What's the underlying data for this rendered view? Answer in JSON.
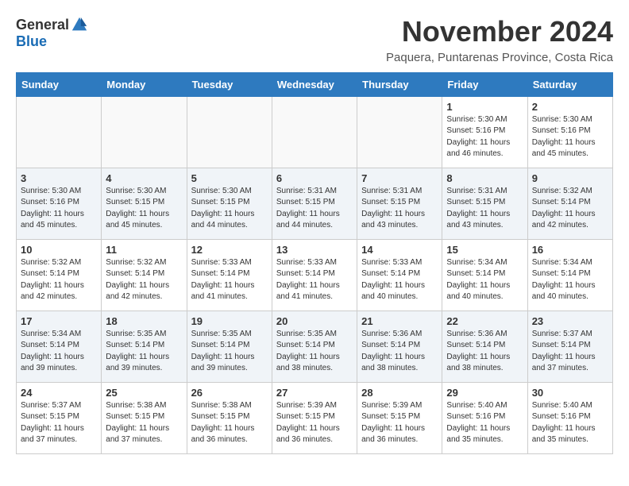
{
  "logo": {
    "general": "General",
    "blue": "Blue"
  },
  "header": {
    "month": "November 2024",
    "location": "Paquera, Puntarenas Province, Costa Rica"
  },
  "weekdays": [
    "Sunday",
    "Monday",
    "Tuesday",
    "Wednesday",
    "Thursday",
    "Friday",
    "Saturday"
  ],
  "weeks": [
    [
      {
        "day": "",
        "info": ""
      },
      {
        "day": "",
        "info": ""
      },
      {
        "day": "",
        "info": ""
      },
      {
        "day": "",
        "info": ""
      },
      {
        "day": "",
        "info": ""
      },
      {
        "day": "1",
        "info": "Sunrise: 5:30 AM\nSunset: 5:16 PM\nDaylight: 11 hours\nand 46 minutes."
      },
      {
        "day": "2",
        "info": "Sunrise: 5:30 AM\nSunset: 5:16 PM\nDaylight: 11 hours\nand 45 minutes."
      }
    ],
    [
      {
        "day": "3",
        "info": "Sunrise: 5:30 AM\nSunset: 5:16 PM\nDaylight: 11 hours\nand 45 minutes."
      },
      {
        "day": "4",
        "info": "Sunrise: 5:30 AM\nSunset: 5:15 PM\nDaylight: 11 hours\nand 45 minutes."
      },
      {
        "day": "5",
        "info": "Sunrise: 5:30 AM\nSunset: 5:15 PM\nDaylight: 11 hours\nand 44 minutes."
      },
      {
        "day": "6",
        "info": "Sunrise: 5:31 AM\nSunset: 5:15 PM\nDaylight: 11 hours\nand 44 minutes."
      },
      {
        "day": "7",
        "info": "Sunrise: 5:31 AM\nSunset: 5:15 PM\nDaylight: 11 hours\nand 43 minutes."
      },
      {
        "day": "8",
        "info": "Sunrise: 5:31 AM\nSunset: 5:15 PM\nDaylight: 11 hours\nand 43 minutes."
      },
      {
        "day": "9",
        "info": "Sunrise: 5:32 AM\nSunset: 5:14 PM\nDaylight: 11 hours\nand 42 minutes."
      }
    ],
    [
      {
        "day": "10",
        "info": "Sunrise: 5:32 AM\nSunset: 5:14 PM\nDaylight: 11 hours\nand 42 minutes."
      },
      {
        "day": "11",
        "info": "Sunrise: 5:32 AM\nSunset: 5:14 PM\nDaylight: 11 hours\nand 42 minutes."
      },
      {
        "day": "12",
        "info": "Sunrise: 5:33 AM\nSunset: 5:14 PM\nDaylight: 11 hours\nand 41 minutes."
      },
      {
        "day": "13",
        "info": "Sunrise: 5:33 AM\nSunset: 5:14 PM\nDaylight: 11 hours\nand 41 minutes."
      },
      {
        "day": "14",
        "info": "Sunrise: 5:33 AM\nSunset: 5:14 PM\nDaylight: 11 hours\nand 40 minutes."
      },
      {
        "day": "15",
        "info": "Sunrise: 5:34 AM\nSunset: 5:14 PM\nDaylight: 11 hours\nand 40 minutes."
      },
      {
        "day": "16",
        "info": "Sunrise: 5:34 AM\nSunset: 5:14 PM\nDaylight: 11 hours\nand 40 minutes."
      }
    ],
    [
      {
        "day": "17",
        "info": "Sunrise: 5:34 AM\nSunset: 5:14 PM\nDaylight: 11 hours\nand 39 minutes."
      },
      {
        "day": "18",
        "info": "Sunrise: 5:35 AM\nSunset: 5:14 PM\nDaylight: 11 hours\nand 39 minutes."
      },
      {
        "day": "19",
        "info": "Sunrise: 5:35 AM\nSunset: 5:14 PM\nDaylight: 11 hours\nand 39 minutes."
      },
      {
        "day": "20",
        "info": "Sunrise: 5:35 AM\nSunset: 5:14 PM\nDaylight: 11 hours\nand 38 minutes."
      },
      {
        "day": "21",
        "info": "Sunrise: 5:36 AM\nSunset: 5:14 PM\nDaylight: 11 hours\nand 38 minutes."
      },
      {
        "day": "22",
        "info": "Sunrise: 5:36 AM\nSunset: 5:14 PM\nDaylight: 11 hours\nand 38 minutes."
      },
      {
        "day": "23",
        "info": "Sunrise: 5:37 AM\nSunset: 5:14 PM\nDaylight: 11 hours\nand 37 minutes."
      }
    ],
    [
      {
        "day": "24",
        "info": "Sunrise: 5:37 AM\nSunset: 5:15 PM\nDaylight: 11 hours\nand 37 minutes."
      },
      {
        "day": "25",
        "info": "Sunrise: 5:38 AM\nSunset: 5:15 PM\nDaylight: 11 hours\nand 37 minutes."
      },
      {
        "day": "26",
        "info": "Sunrise: 5:38 AM\nSunset: 5:15 PM\nDaylight: 11 hours\nand 36 minutes."
      },
      {
        "day": "27",
        "info": "Sunrise: 5:39 AM\nSunset: 5:15 PM\nDaylight: 11 hours\nand 36 minutes."
      },
      {
        "day": "28",
        "info": "Sunrise: 5:39 AM\nSunset: 5:15 PM\nDaylight: 11 hours\nand 36 minutes."
      },
      {
        "day": "29",
        "info": "Sunrise: 5:40 AM\nSunset: 5:16 PM\nDaylight: 11 hours\nand 35 minutes."
      },
      {
        "day": "30",
        "info": "Sunrise: 5:40 AM\nSunset: 5:16 PM\nDaylight: 11 hours\nand 35 minutes."
      }
    ]
  ]
}
